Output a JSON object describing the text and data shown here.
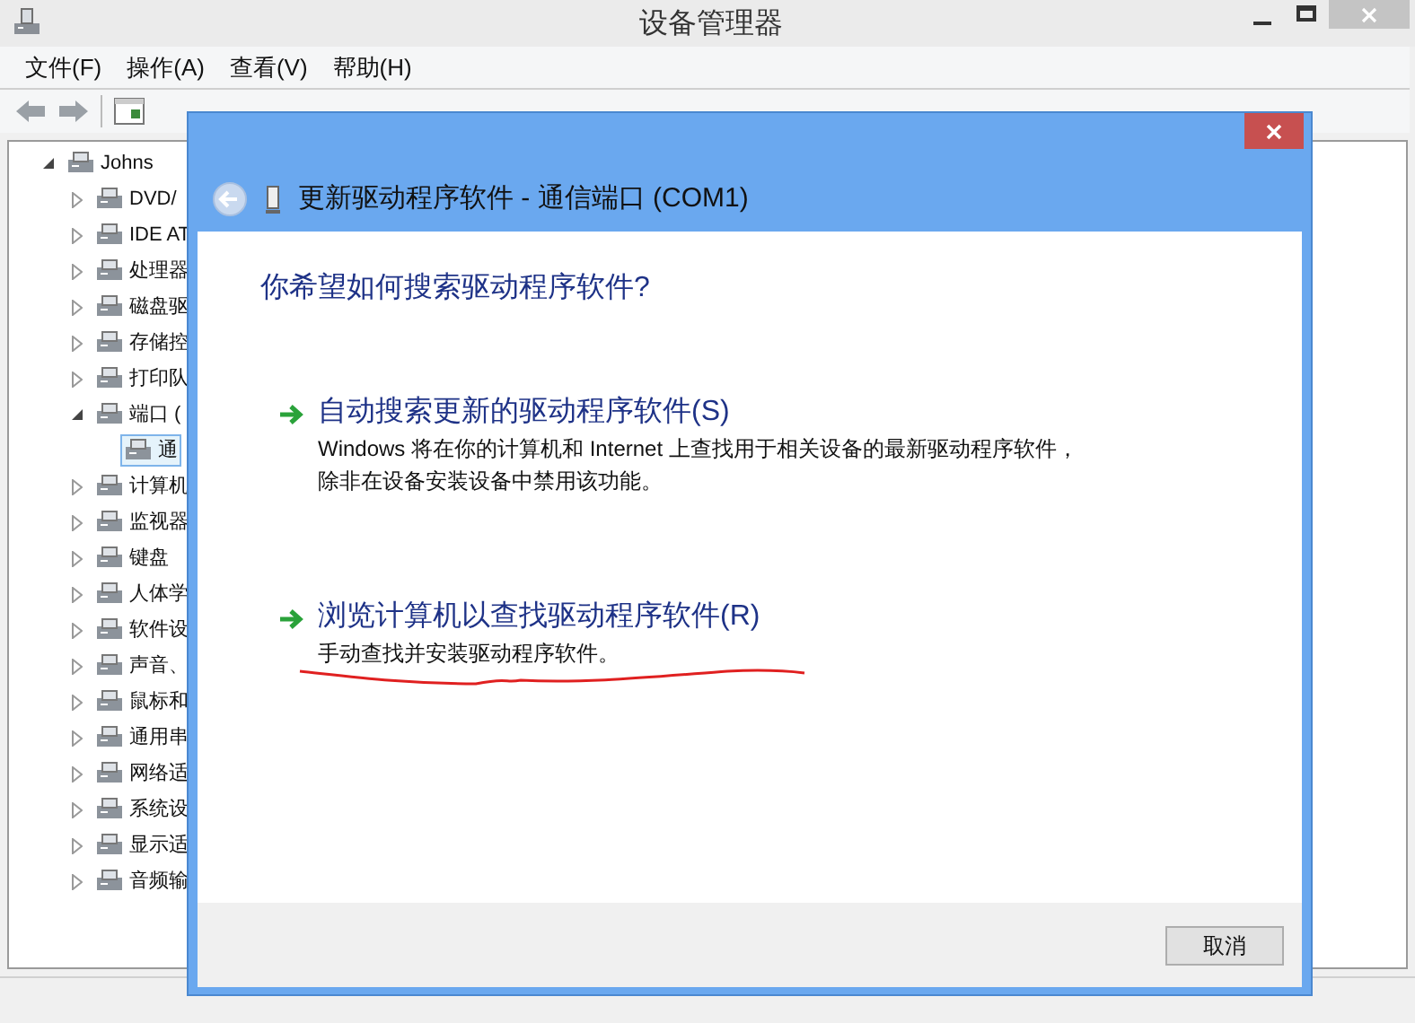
{
  "window": {
    "title": "设备管理器"
  },
  "menu": [
    {
      "label": "文件(F)"
    },
    {
      "label": "操作(A)"
    },
    {
      "label": "查看(V)"
    },
    {
      "label": "帮助(H)"
    }
  ],
  "tree": {
    "label": "Johns",
    "expanded": true,
    "children": [
      {
        "label": "DVD/",
        "expanded": false
      },
      {
        "label": "IDE AT",
        "expanded": false
      },
      {
        "label": "处理器",
        "expanded": false
      },
      {
        "label": "磁盘驱",
        "expanded": false
      },
      {
        "label": "存储控",
        "expanded": false
      },
      {
        "label": "打印队",
        "expanded": false
      },
      {
        "label": "端口 (",
        "expanded": true,
        "children": [
          {
            "label": "通",
            "selected": true
          }
        ]
      },
      {
        "label": "计算机",
        "expanded": false
      },
      {
        "label": "监视器",
        "expanded": false
      },
      {
        "label": "键盘",
        "expanded": false
      },
      {
        "label": "人体学",
        "expanded": false
      },
      {
        "label": "软件设",
        "expanded": false
      },
      {
        "label": "声音、",
        "expanded": false
      },
      {
        "label": "鼠标和",
        "expanded": false
      },
      {
        "label": "通用串",
        "expanded": false
      },
      {
        "label": "网络适",
        "expanded": false
      },
      {
        "label": "系统设",
        "expanded": false
      },
      {
        "label": "显示适",
        "expanded": false
      },
      {
        "label": "音频输",
        "expanded": false
      }
    ]
  },
  "dialog": {
    "title": "更新驱动程序软件 - 通信端口 (COM1)",
    "question": "你希望如何搜索驱动程序软件?",
    "options": [
      {
        "title": "自动搜索更新的驱动程序软件(S)",
        "description": "Windows 将在你的计算机和 Internet 上查找用于相关设备的最新驱动程序软件，除非在设备安装设备中禁用该功能。"
      },
      {
        "title": "浏览计算机以查找驱动程序软件(R)",
        "description": "手动查找并安装驱动程序软件。"
      }
    ],
    "buttons": [
      "取消"
    ]
  }
}
